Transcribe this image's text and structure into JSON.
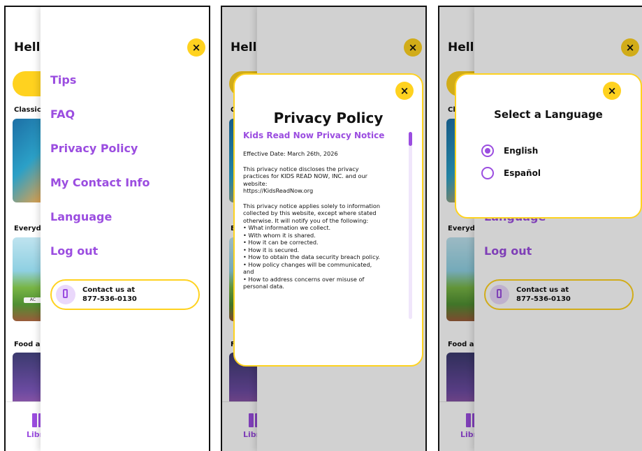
{
  "background": {
    "greeting": "Hello",
    "sections": [
      "Classics",
      "Everyday",
      "Food and"
    ],
    "card_label": "AC",
    "nav_label": "Library"
  },
  "drawer": {
    "menu": [
      "Tips",
      "FAQ",
      "Privacy Policy",
      "My Contact Info",
      "Language",
      "Log out"
    ],
    "contact_line1": "Contact us at",
    "contact_line2": "877-536-0130",
    "close_icon": "×"
  },
  "privacy": {
    "title": "Privacy Policy",
    "subtitle": "Kids Read Now Privacy Notice",
    "effective": "Effective Date: March 26th, 2026",
    "p1_lines": [
      "This privacy notice discloses the privacy",
      "practices for KIDS READ NOW, INC. and our",
      "website:",
      "https://KidsReadNow.org"
    ],
    "p2_lines": [
      "This privacy notice applies solely to information",
      "collected by this website, except where stated",
      "otherwise. It will notify you of the following:",
      "• What information we collect.",
      "• With whom it is shared.",
      "• How it can be corrected.",
      "• How it is secured.",
      "• How to obtain the data security breach policy.",
      "• How policy changes will be communicated,",
      "and",
      "• How to address concerns over misuse of",
      "personal data."
    ]
  },
  "language": {
    "title": "Select a Language",
    "options": [
      {
        "label": "English",
        "selected": true
      },
      {
        "label": "Español",
        "selected": false
      }
    ]
  },
  "colors": {
    "accent": "#9b4de0",
    "brand_yellow": "#ffd21f"
  }
}
